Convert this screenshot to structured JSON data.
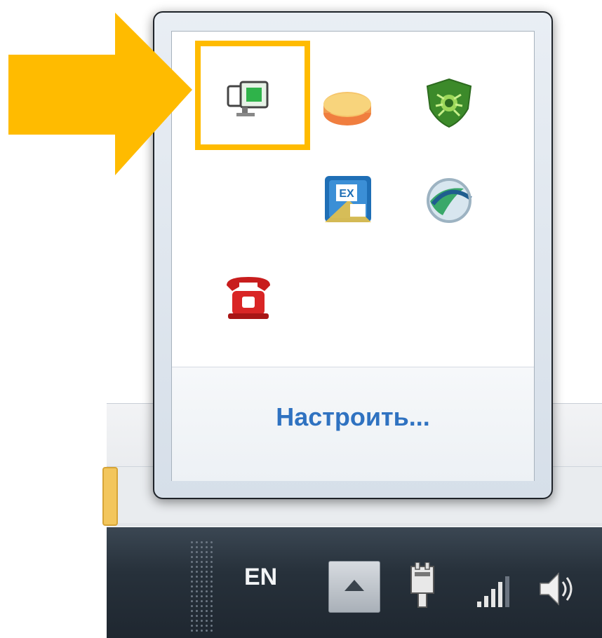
{
  "flyout": {
    "customize_label": "Настроить...",
    "icons": [
      {
        "name": "display-settings-icon"
      },
      {
        "name": "database-app-icon"
      },
      {
        "name": "antivirus-spider-icon"
      },
      {
        "name": "calendar-app-icon"
      },
      {
        "name": "browser-globe-icon"
      },
      {
        "name": "telephone-icon"
      }
    ]
  },
  "taskbar": {
    "language": "EN"
  },
  "annotation": {
    "arrow_color": "#ffbb00",
    "highlight_color": "#ffbb00"
  }
}
